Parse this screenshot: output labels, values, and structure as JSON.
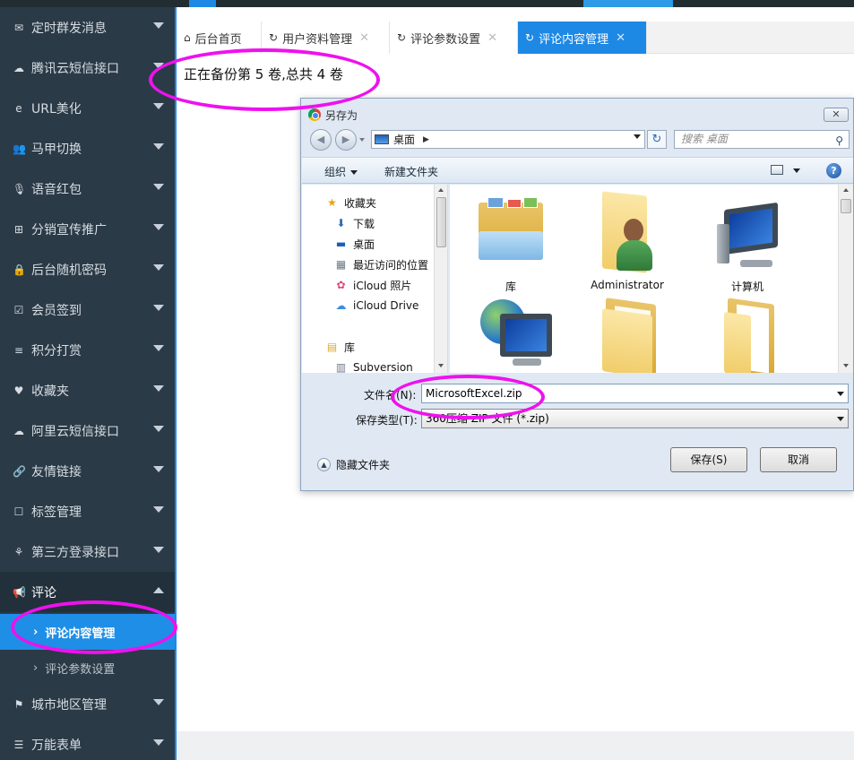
{
  "sidebar": {
    "items": [
      {
        "label": "定时群发消息",
        "icon": "envelope-icon",
        "glyph": "✉"
      },
      {
        "label": "腾讯云短信接口",
        "icon": "cloud-message-icon",
        "glyph": "☁"
      },
      {
        "label": "URL美化",
        "icon": "ie-icon",
        "glyph": "e"
      },
      {
        "label": "马甲切换",
        "icon": "users-icon",
        "glyph": "👥"
      },
      {
        "label": "语音红包",
        "icon": "microphone-icon",
        "glyph": "🎙"
      },
      {
        "label": "分销宣传推广",
        "icon": "sitemap-icon",
        "glyph": "⊞"
      },
      {
        "label": "后台随机密码",
        "icon": "lock-icon",
        "glyph": "🔒"
      },
      {
        "label": "会员签到",
        "icon": "calendar-check-icon",
        "glyph": "☑"
      },
      {
        "label": "积分打赏",
        "icon": "database-icon",
        "glyph": "≡"
      },
      {
        "label": "收藏夹",
        "icon": "heart-icon",
        "glyph": "♥"
      },
      {
        "label": "阿里云短信接口",
        "icon": "cloud-message-icon",
        "glyph": "☁"
      },
      {
        "label": "友情链接",
        "icon": "link-icon",
        "glyph": "🔗"
      },
      {
        "label": "标签管理",
        "icon": "tag-icon",
        "glyph": "☐"
      },
      {
        "label": "第三方登录接口",
        "icon": "handshake-icon",
        "glyph": "⚘"
      },
      {
        "label": "评论",
        "icon": "bullhorn-icon",
        "glyph": "📢"
      },
      {
        "label": "城市地区管理",
        "icon": "flag-icon",
        "glyph": "⚑"
      },
      {
        "label": "万能表单",
        "icon": "list-icon",
        "glyph": "☰"
      }
    ],
    "sub_items": [
      {
        "label": "评论内容管理"
      },
      {
        "label": "评论参数设置"
      }
    ]
  },
  "tabs": [
    {
      "label": "后台首页",
      "icon": "home-icon",
      "glyph": "⌂"
    },
    {
      "label": "用户资料管理",
      "icon": "refresh-icon",
      "glyph": "↻"
    },
    {
      "label": "评论参数设置",
      "icon": "refresh-icon",
      "glyph": "↻"
    },
    {
      "label": "评论内容管理",
      "icon": "refresh-icon",
      "glyph": "↻"
    }
  ],
  "tab_close": "✕",
  "status_text": "正在备份第 5 卷,总共 4 卷",
  "dialog": {
    "title": "另存为",
    "close": "✕",
    "address": "桌面",
    "search_placeholder": "搜索 桌面",
    "organize": "组织",
    "new_folder": "新建文件夹",
    "help": "?",
    "nav": [
      {
        "label": "收藏夹",
        "icon": "star-icon",
        "glyph": "★",
        "color": "#e8a317"
      },
      {
        "label": "下载",
        "icon": "download-folder-icon",
        "glyph": "⬇",
        "color": "#2b6cb5"
      },
      {
        "label": "桌面",
        "icon": "desktop-icon",
        "glyph": "▬",
        "color": "#1d5fb8"
      },
      {
        "label": "最近访问的位置",
        "icon": "recent-places-icon",
        "glyph": "▦",
        "color": "#6a7a8a"
      },
      {
        "label": "iCloud 照片",
        "icon": "icloud-photos-icon",
        "glyph": "✿",
        "color": "#e0457b"
      },
      {
        "label": "iCloud Drive",
        "icon": "icloud-drive-icon",
        "glyph": "☁",
        "color": "#3c8de0"
      },
      {
        "label": "库",
        "icon": "library-icon",
        "glyph": "▤",
        "color": "#d9a930"
      },
      {
        "label": "Subversion",
        "icon": "subversion-icon",
        "glyph": "▥",
        "color": "#6a7a8a"
      }
    ],
    "files": [
      {
        "label": "库",
        "kind": "library"
      },
      {
        "label": "Administrator",
        "kind": "user"
      },
      {
        "label": "计算机",
        "kind": "computer"
      },
      {
        "label": "",
        "kind": "network"
      },
      {
        "label": "",
        "kind": "folder"
      },
      {
        "label": "",
        "kind": "folder"
      }
    ],
    "filename_label": "文件名(N):",
    "filename_value": "MicrosoftExcel.zip",
    "filetype_label": "保存类型(T):",
    "filetype_value": "360压缩 ZIP 文件 (*.zip)",
    "hide_folders": "隐藏文件夹",
    "save_button": "保存(S)",
    "cancel_button": "取消"
  },
  "colors": {
    "sidebar_bg": "#2b3a47",
    "accent": "#1e88e5",
    "annotation": "#ee11ee"
  }
}
